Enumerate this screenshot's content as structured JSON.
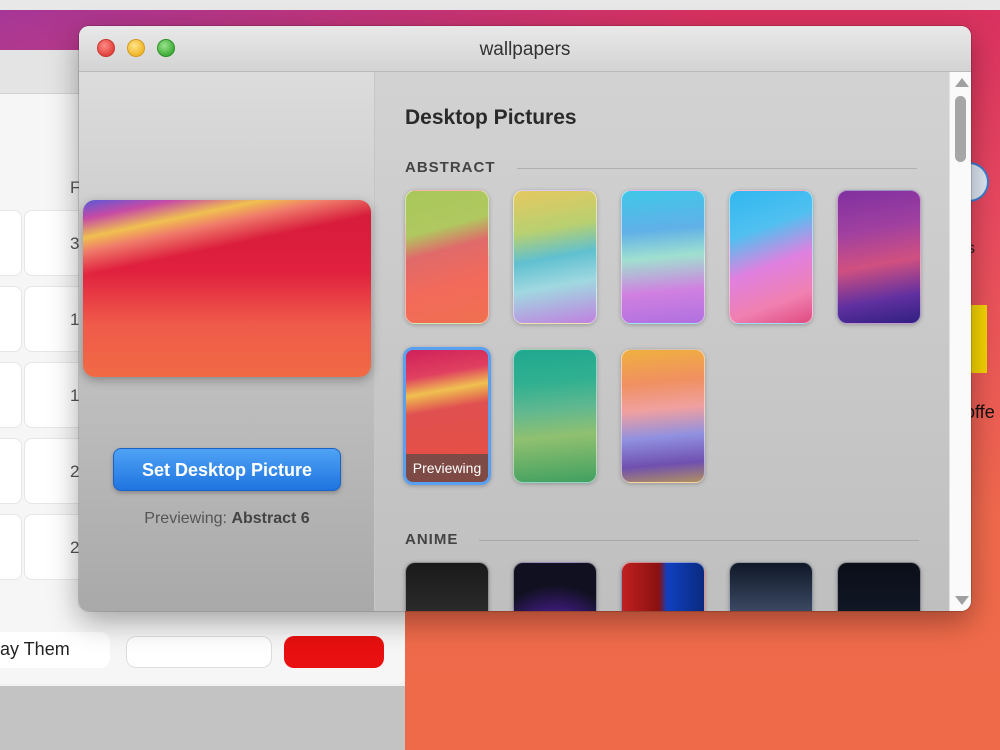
{
  "window": {
    "title": "wallpapers"
  },
  "left_pane": {
    "set_button_label": "Set Desktop Picture",
    "previewing_prefix": "Previewing:",
    "previewing_name": "Abstract 6"
  },
  "right_pane": {
    "heading": "Desktop Pictures",
    "sections": [
      {
        "label": "ABSTRACT",
        "thumbnail_count": 8,
        "selected_index": 5,
        "selected_badge": "Previewing"
      },
      {
        "label": "ANIME",
        "thumbnail_count": 5
      }
    ]
  },
  "background_app": {
    "visible_button_label": "lay Them",
    "visible_numbers": [
      "F",
      "3",
      "1",
      "1",
      "2",
      "2"
    ]
  },
  "right_app": {
    "visible_text": "offe",
    "visible_letter": "s"
  },
  "colors": {
    "accent_button": "#1f74e0",
    "selection_border": "#5aa0f0",
    "close": "#e0443e",
    "minimize": "#f0b62a",
    "zoom": "#3fae3a"
  },
  "icons": [
    "close-button",
    "minimize-button",
    "zoom-button",
    "scroll-up-arrow",
    "scroll-down-arrow"
  ]
}
